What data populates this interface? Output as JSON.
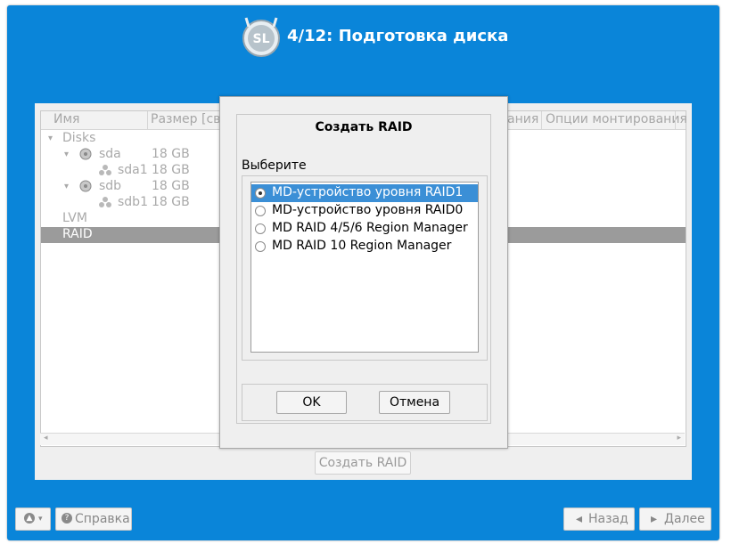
{
  "header": {
    "title": "4/12: Подготовка диска",
    "logo_text": "SL"
  },
  "table": {
    "columns": [
      "Имя",
      "Размер [св",
      "ания",
      "Опции монтирования"
    ],
    "rows": [
      {
        "expander": "▾",
        "name": "Disks"
      },
      {
        "expander": "▾",
        "name": "sda",
        "size": "18 GB"
      },
      {
        "name": "sda1",
        "size": "18 GB"
      },
      {
        "expander": "▾",
        "name": "sdb",
        "size": "18 GB"
      },
      {
        "name": "sdb1",
        "size": "18 GB"
      },
      {
        "name": "LVM"
      },
      {
        "name": "RAID",
        "selected": true
      }
    ]
  },
  "create_raid_button": "Создать RAID",
  "dialog": {
    "title": "Создать RAID",
    "prompt": "Выберите",
    "options": [
      {
        "label": "MD-устройство уровня RAID1",
        "selected": true
      },
      {
        "label": "MD-устройство уровня RAID0",
        "selected": false
      },
      {
        "label": "MD RAID 4/5/6 Region Manager",
        "selected": false
      },
      {
        "label": "MD RAID 10 Region Manager",
        "selected": false
      }
    ],
    "ok_label": "OK",
    "cancel_label": "Отмена"
  },
  "footer": {
    "help_label": "Справка",
    "back_label": "Назад",
    "next_label": "Далее"
  },
  "colors": {
    "frame": "#0a85d9",
    "selection": "#3b8fd6",
    "tree_selection": "#9b9b9b"
  }
}
